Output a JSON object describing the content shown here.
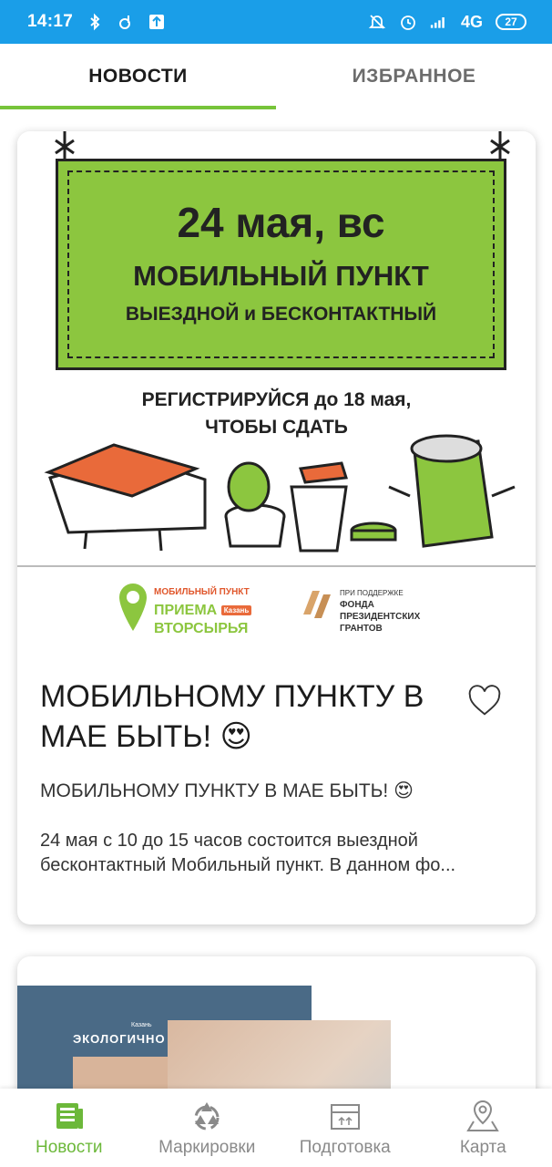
{
  "status_bar": {
    "time": "14:17",
    "network": "4G",
    "battery": "27"
  },
  "tabs": [
    {
      "label": "НОВОСТИ",
      "active": true
    },
    {
      "label": "ИЗБРАННОЕ",
      "active": false
    }
  ],
  "news_card": {
    "image": {
      "banner_date": "24 мая, вс",
      "banner_title": "МОБИЛЬНЫЙ ПУНКТ",
      "banner_subtitle": "ВЫЕЗДНОЙ и БЕСКОНТАКТНЫЙ",
      "register_line1": "РЕГИСТРИРУЙСЯ до 18 мая,",
      "register_line2": "ЧТОБЫ СДАТЬ",
      "logo_left_line1": "МОБИЛЬНЫЙ ПУНКТ",
      "logo_left_line2": "ПРИЕМА",
      "logo_left_tag": "Казань",
      "logo_left_line3": "ВТОРСЫРЬЯ",
      "logo_right_line1": "ПРИ ПОДДЕРЖКЕ",
      "logo_right_line2": "ФОНДА",
      "logo_right_line3": "ПРЕЗИДЕНТСКИХ",
      "logo_right_line4": "ГРАНТОВ"
    },
    "title": "МОБИЛЬНОМУ ПУНКТУ В МАЕ БЫТЬ! 😍",
    "subtitle": "МОБИЛЬНОМУ ПУНКТУ В МАЕ БЫТЬ! 😍",
    "excerpt": "24 мая с 10 до 15 часов состоится выездной бесконтактный Мобильный пункт. В данном фо...",
    "favorite": false
  },
  "second_card": {
    "label": "ЭКОЛОГИЧНО",
    "tag": "Казань"
  },
  "bottom_nav": [
    {
      "label": "Новости",
      "icon": "news-icon",
      "active": true
    },
    {
      "label": "Маркировки",
      "icon": "recycle-icon",
      "active": false
    },
    {
      "label": "Подготовка",
      "icon": "box-icon",
      "active": false
    },
    {
      "label": "Карта",
      "icon": "map-icon",
      "active": false
    }
  ],
  "colors": {
    "status_bar": "#1a9ee8",
    "accent_green": "#77c43a",
    "banner_green": "#8cc63f",
    "nav_inactive": "#8a8a8a"
  }
}
